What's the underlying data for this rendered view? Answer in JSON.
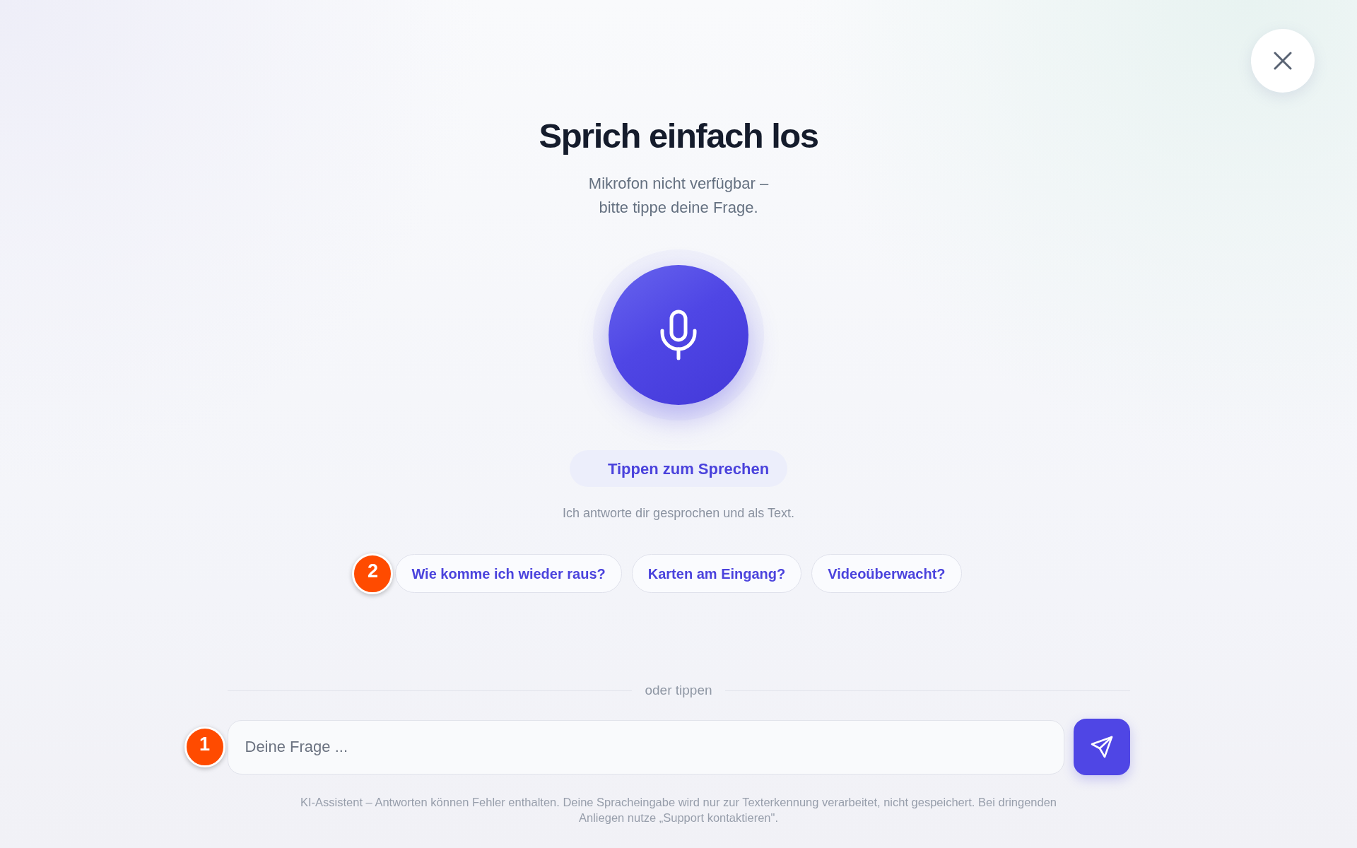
{
  "header": {
    "title": "Sprich einfach los",
    "subtitle": "Mikrofon nicht verfügbar –\nbitte tippe deine Frage."
  },
  "voice": {
    "tap_button": "Tippen zum Sprechen",
    "hint": "Ich antworte dir gesprochen und als Text."
  },
  "suggestions": [
    {
      "label": "Wie komme ich wieder raus?",
      "marker": "2"
    },
    {
      "label": "Karten am Eingang?"
    },
    {
      "label": "Videoüberwacht?"
    }
  ],
  "divider": {
    "label": "oder tippen"
  },
  "input": {
    "placeholder": "Deine Frage ...",
    "marker": "1"
  },
  "disclaimer": "KI-Assistent – Antworten können Fehler enthalten. Deine Spracheingabe wird nur zur Texterkennung verarbeitet, nicht gespeichert. Bei dringenden\nAnliegen nutze „Support kontaktieren\"."
}
